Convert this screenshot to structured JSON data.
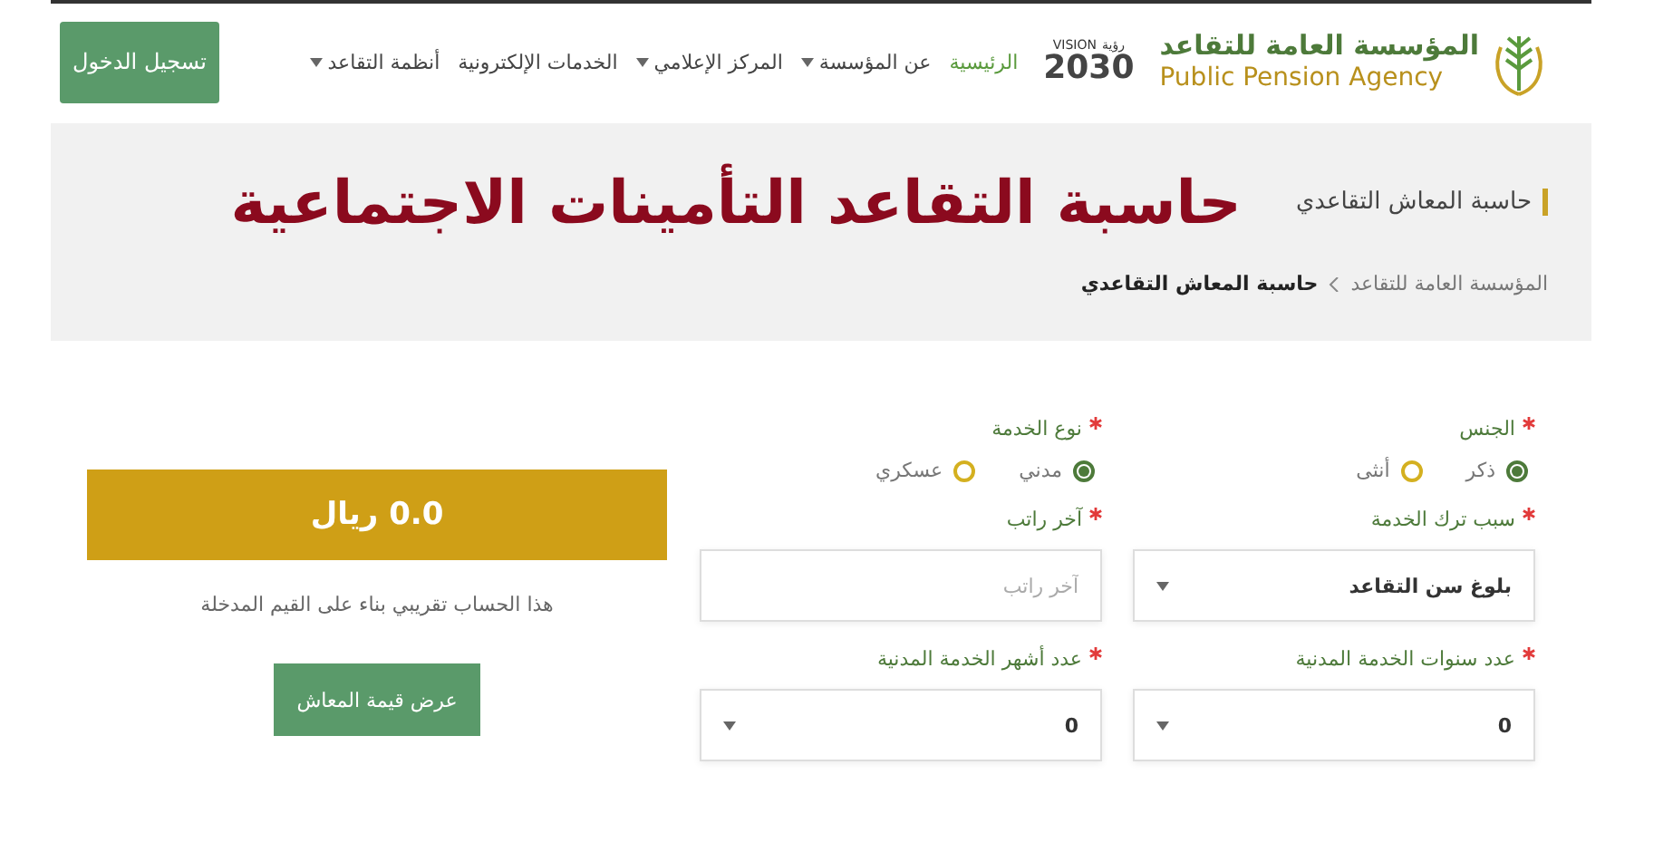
{
  "header": {
    "org_name_ar": "المؤسسة العامة للتقاعد",
    "org_name_en": "Public Pension Agency",
    "vision": {
      "word": "VISION",
      "word_ar": "رؤية",
      "number": "2030"
    },
    "nav": [
      {
        "label": "الرئيسية",
        "selected": true,
        "dropdown": false
      },
      {
        "label": "عن المؤسسة",
        "selected": false,
        "dropdown": true
      },
      {
        "label": "المركز الإعلامي",
        "selected": false,
        "dropdown": true
      },
      {
        "label": "الخدمات الإلكترونية",
        "selected": false,
        "dropdown": false
      },
      {
        "label": "أنظمة التقاعد",
        "selected": false,
        "dropdown": true
      }
    ],
    "login_button": "تسجيل الدخول"
  },
  "banner": {
    "title": "حاسبة المعاش التقاعدي",
    "overlay_title": "حاسبة التقاعد التأمينات الاجتماعية",
    "breadcrumb": [
      {
        "label": "المؤسسة العامة للتقاعد",
        "current": false
      },
      {
        "label": "حاسبة المعاش التقاعدي",
        "current": true
      }
    ]
  },
  "form": {
    "fields": [
      {
        "kind": "radio",
        "label": "الجنس",
        "required": true,
        "options": [
          {
            "label": "ذكر",
            "selected": true
          },
          {
            "label": "أنثى",
            "selected": false
          }
        ]
      },
      {
        "kind": "radio",
        "label": "نوع الخدمة",
        "required": true,
        "options": [
          {
            "label": "مدني",
            "selected": true
          },
          {
            "label": "عسكري",
            "selected": false
          }
        ]
      },
      {
        "kind": "select",
        "label": "سبب ترك الخدمة",
        "required": true,
        "value": "بلوغ سن التقاعد"
      },
      {
        "kind": "input",
        "label": "آخر راتب",
        "required": true,
        "placeholder": "آخر راتب"
      },
      {
        "kind": "select",
        "label": "عدد سنوات الخدمة المدنية",
        "required": true,
        "value": "0"
      },
      {
        "kind": "select",
        "label": "عدد أشهر الخدمة المدنية",
        "required": true,
        "value": "0"
      }
    ]
  },
  "result": {
    "amount": "0.0 ريال",
    "note": "هذا الحساب تقريبي بناء على القيم المدخلة",
    "button": "عرض قيمة المعاش"
  }
}
